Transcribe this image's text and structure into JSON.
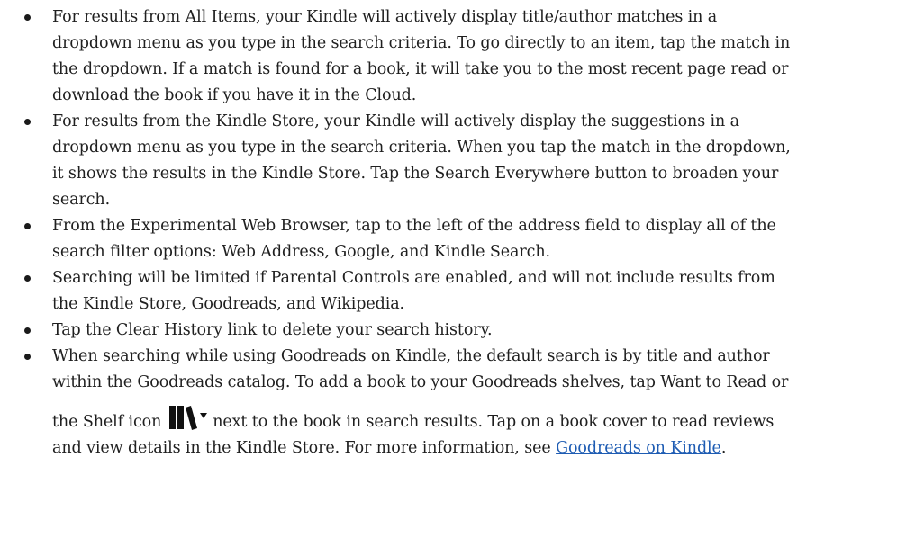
{
  "bullets": [
    {
      "lines": [
        "For results from All Items, your Kindle will actively display title/author matches in a",
        "dropdown menu as you type in the search criteria. To go directly to an item, tap the match in",
        "the dropdown. If a match is found for a book, it will take you to the most recent page read or",
        "download the book if you have it in the Cloud."
      ]
    },
    {
      "lines": [
        "For results from the Kindle Store, your Kindle will actively display the suggestions in a",
        "dropdown menu as you type in the search criteria. When you tap the match in the dropdown,",
        "it shows the results in the Kindle Store. Tap the Search Everywhere button to broaden your",
        "search."
      ]
    },
    {
      "lines": [
        "From the Experimental Web Browser, tap to the left of the address field to display all of the",
        "search filter options: Web Address, Google, and Kindle Search."
      ]
    },
    {
      "lines": [
        "Searching will be limited if Parental Controls are enabled, and will not include results from",
        "the Kindle Store, Goodreads, and Wikipedia."
      ]
    },
    {
      "lines": [
        "Tap the Clear History link to delete your search history."
      ]
    },
    {
      "lines": [
        "When searching while using Goodreads on Kindle, the default search is by title and author",
        "within the Goodreads catalog. To add a book to your Goodreads shelves, tap Want to Read or"
      ],
      "shelf_line_before": "the Shelf icon",
      "shelf_line_after": "next to the book in search results. Tap on a book cover to read reviews",
      "last_line_before": "and view details in the Kindle Store. For more information, see ",
      "link_text": "Goodreads on Kindle",
      "last_line_after": ".",
      "icon": "shelf-icon"
    }
  ],
  "colors": {
    "text": "#1f1f1f",
    "link": "#1e5cb3",
    "icon": "#111111"
  }
}
